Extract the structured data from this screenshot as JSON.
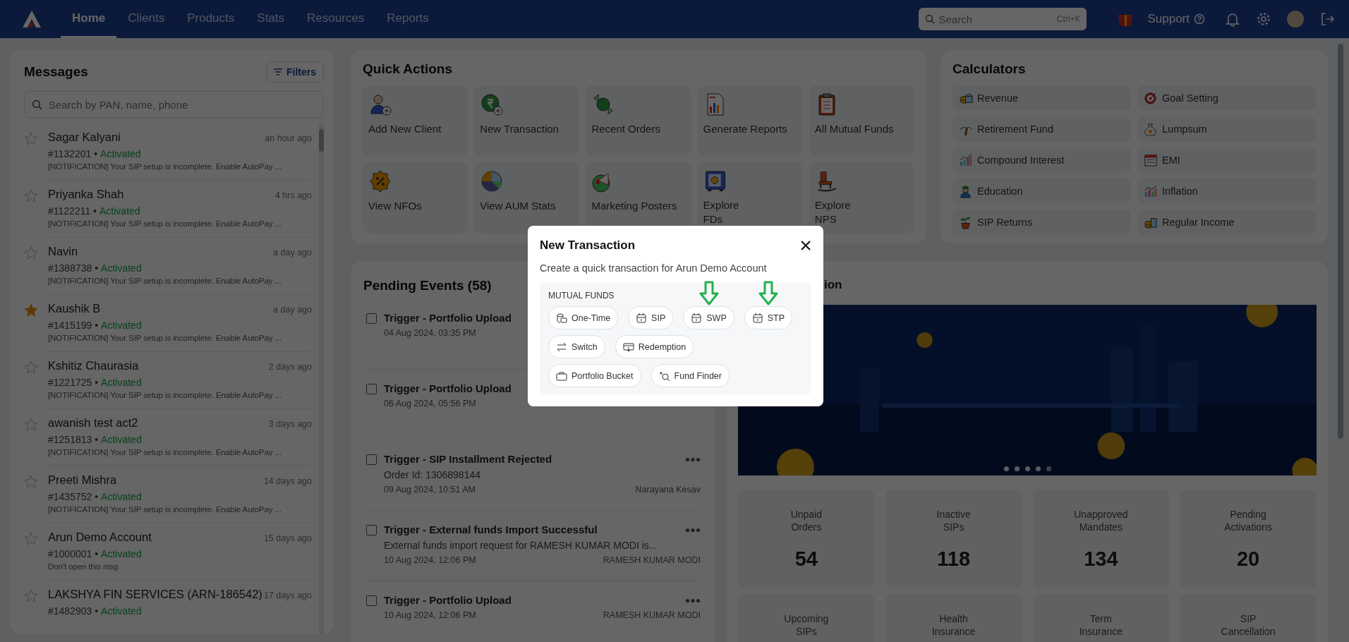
{
  "nav": {
    "tabs": [
      {
        "label": "Home",
        "selected": true
      },
      {
        "label": "Clients",
        "selected": false
      },
      {
        "label": "Products",
        "selected": false
      },
      {
        "label": "Stats",
        "selected": false
      },
      {
        "label": "Resources",
        "selected": false
      },
      {
        "label": "Reports",
        "selected": false
      }
    ],
    "search": {
      "placeholder": "Search",
      "shortcut": "Ctrl+K"
    },
    "support": "Support"
  },
  "messages": {
    "title": "Messages",
    "filters": "Filters",
    "search_placeholder": "Search by PAN, name, phone",
    "items": [
      {
        "name": "Sagar Kalyani",
        "time": "an hour ago",
        "code": "#1132201 •",
        "status": "Activated",
        "preview": "[NOTIFICATION] Your SIP setup is incomplete. Enable AutoPay ...",
        "starred": false
      },
      {
        "name": "Priyanka Shah",
        "time": "4 hrs ago",
        "code": "#1122211 •",
        "status": "Activated",
        "preview": "[NOTIFICATION] Your SIP setup is incomplete. Enable AutoPay ...",
        "starred": false
      },
      {
        "name": "Navin",
        "time": "a day ago",
        "code": "#1388738 •",
        "status": "Activated",
        "preview": "[NOTIFICATION] Your SIP setup is incomplete. Enable AutoPay ...",
        "starred": false
      },
      {
        "name": "Kaushik B",
        "time": "a day ago",
        "code": "#1415199 •",
        "status": "Activated",
        "preview": "[NOTIFICATION] Your SIP setup is incomplete. Enable AutoPay ...",
        "starred": true
      },
      {
        "name": "Kshitiz Chaurasia",
        "time": "2 days ago",
        "code": "#1221725 •",
        "status": "Activated",
        "preview": "[NOTIFICATION] Your SIP setup is incomplete. Enable AutoPay ...",
        "starred": false
      },
      {
        "name": "awanish test act2",
        "time": "3 days ago",
        "code": "#1251813 •",
        "status": "Activated",
        "preview": "[NOTIFICATION] Your SIP setup is incomplete. Enable AutoPay ...",
        "starred": false
      },
      {
        "name": "Preeti Mishra",
        "time": "14 days ago",
        "code": "#1435752 •",
        "status": "Activated",
        "preview": "[NOTIFICATION] Your SIP setup is incomplete. Enable AutoPay ...",
        "starred": false
      },
      {
        "name": "Arun Demo Account",
        "time": "15 days ago",
        "code": "#1000001 •",
        "status": "Activated",
        "preview": "Don't open this msg",
        "starred": false
      },
      {
        "name": "LAKSHYA FIN SERVICES (ARN-186542)",
        "time": "17 days ago",
        "code": "#1482903 •",
        "status": "Activated",
        "starred": false
      }
    ]
  },
  "quick_actions": {
    "title": "Quick Actions",
    "items": [
      {
        "label": "Add New Client"
      },
      {
        "label": "New Transaction"
      },
      {
        "label": "Recent Orders"
      },
      {
        "label": "Generate Reports"
      },
      {
        "label": "All Mutual Funds"
      },
      {
        "label": "View NFOs"
      },
      {
        "label": "View AUM Stats"
      },
      {
        "label": "Marketing Posters"
      },
      {
        "label": "Explore\nFDs"
      },
      {
        "label": "Explore\nNPS"
      }
    ]
  },
  "calculators": {
    "title": "Calculators",
    "items": [
      {
        "label": "Revenue"
      },
      {
        "label": "Goal Setting"
      },
      {
        "label": "Retirement Fund"
      },
      {
        "label": "Lumpsum"
      },
      {
        "label": "Compound Interest"
      },
      {
        "label": "EMI"
      },
      {
        "label": "Education"
      },
      {
        "label": "Inflation"
      },
      {
        "label": "SIP Returns"
      },
      {
        "label": "Regular Income"
      }
    ]
  },
  "pending_events": {
    "title": "Pending Events (58)",
    "items": [
      {
        "checked": false,
        "title": "Trigger - Portfolio Upload",
        "date": "04 Aug 2024, 03:35 PM",
        "menu": false
      },
      {
        "checked": false,
        "title": "Trigger - Portfolio Upload",
        "date": "06 Aug 2024, 05:56 PM",
        "menu": false
      },
      {
        "checked": false,
        "title": "Trigger - SIP Installment Rejected",
        "detail": "Order Id: 1306898144",
        "date": "09 Aug 2024, 10:51 AM",
        "assignee": "Narayana Kesav",
        "menu": true
      },
      {
        "checked": false,
        "title": "Trigger - External funds Import Successful",
        "detail": "External funds import request for RAMESH KUMAR MODI is...",
        "date": "10 Aug 2024, 12:06 PM",
        "assignee": "RAMESH KUMAR MODI",
        "menu": true
      },
      {
        "checked": false,
        "title": "Trigger - Portfolio Upload",
        "date": "10 Aug 2024, 12:06 PM",
        "assignee": "RAMESH KUMAR MODI",
        "menu": true
      }
    ]
  },
  "promotion": {
    "title": "ion",
    "carousel": [
      {
        "selected": false
      },
      {
        "selected": false
      },
      {
        "selected": false
      },
      {
        "selected": false
      },
      {
        "selected": true
      }
    ],
    "stats": [
      {
        "label": "Unpaid Orders",
        "value": "54"
      },
      {
        "label": "Inactive SIPs",
        "value": "118"
      },
      {
        "label": "Unapproved Mandates",
        "value": "134"
      },
      {
        "label": "Pending Activations",
        "value": "20"
      },
      {
        "label": "Upcoming SIPs"
      },
      {
        "label": "Health Insurance"
      },
      {
        "label": "Term Insurance"
      },
      {
        "label": "SIP Cancellation"
      }
    ]
  },
  "modal": {
    "title": "New Transaction",
    "subtitle": "Create a quick transaction for Arun Demo Account",
    "section": "MUTUAL FUNDS",
    "rows": [
      [
        {
          "label": "One-Time",
          "arrow": false
        },
        {
          "label": "SIP",
          "arrow": false
        },
        {
          "label": "SWP",
          "arrow": true
        },
        {
          "label": "STP",
          "arrow": true
        }
      ],
      [
        {
          "label": "Switch",
          "arrow": false
        },
        {
          "label": "Redemption",
          "arrow": false
        }
      ],
      [
        {
          "label": "Portfolio Bucket",
          "arrow": false
        },
        {
          "label": "Fund Finder",
          "arrow": false
        }
      ]
    ]
  }
}
